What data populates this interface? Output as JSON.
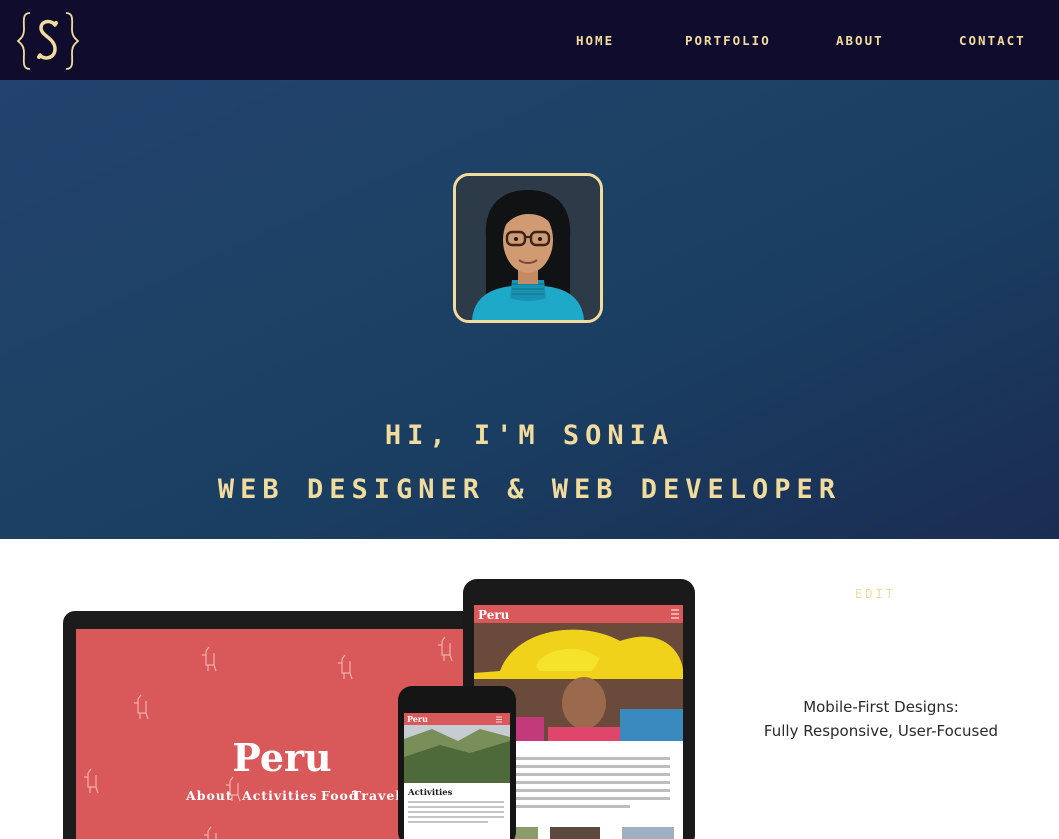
{
  "nav": {
    "logo_icon": "bracketed-s-logo",
    "items": [
      {
        "label": "HOME"
      },
      {
        "label": "PORTFOLIO"
      },
      {
        "label": "ABOUT"
      },
      {
        "label": "CONTACT"
      }
    ]
  },
  "hero": {
    "avatar_icon": "cartoon-avatar",
    "greeting": "HI, I'M SONIA",
    "role": "WEB DESIGNER & WEB DEVELOPER"
  },
  "portfolio": {
    "edit_label": "EDIT",
    "description_line1": "Mobile-First Designs:",
    "description_line2": "Fully Responsive, User-Focused",
    "mockup": {
      "title": "Peru",
      "nav_links": [
        "About",
        "Activities",
        "Food",
        "Travel"
      ],
      "section_heading": "Activities"
    }
  },
  "colors": {
    "nav_bg": "#0f0c2e",
    "accent": "#f1dc9d",
    "hero_start": "#23426e",
    "hero_end": "#1b2c52",
    "mockup_red": "#d9595b"
  }
}
